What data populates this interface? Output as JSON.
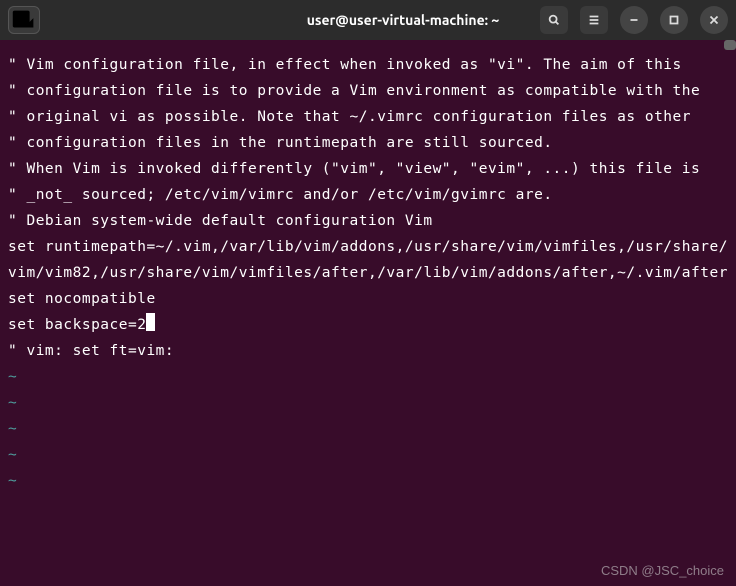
{
  "titlebar": {
    "title": "user@user-virtual-machine: ~"
  },
  "terminal": {
    "lines": [
      "\" Vim configuration file, in effect when invoked as \"vi\". The aim of this",
      "\" configuration file is to provide a Vim environment as compatible with the",
      "\" original vi as possible. Note that ~/.vimrc configuration files as other",
      "\" configuration files in the runtimepath are still sourced.",
      "\" When Vim is invoked differently (\"vim\", \"view\", \"evim\", ...) this file is",
      "\" _not_ sourced; /etc/vim/vimrc and/or /etc/vim/gvimrc are.",
      "",
      "\" Debian system-wide default configuration Vim",
      "set runtimepath=~/.vim,/var/lib/vim/addons,/usr/share/vim/vimfiles,/usr/share/vim/vim82,/usr/share/vim/vimfiles/after,/var/lib/vim/addons/after,~/.vim/after",
      "",
      "set nocompatible",
      "set backspace=2",
      "",
      "\" vim: set ft=vim:"
    ],
    "cursor_line": 11,
    "tildes": [
      "~",
      "~",
      "~",
      "~",
      "~"
    ]
  },
  "watermark": "CSDN @JSC_choice"
}
